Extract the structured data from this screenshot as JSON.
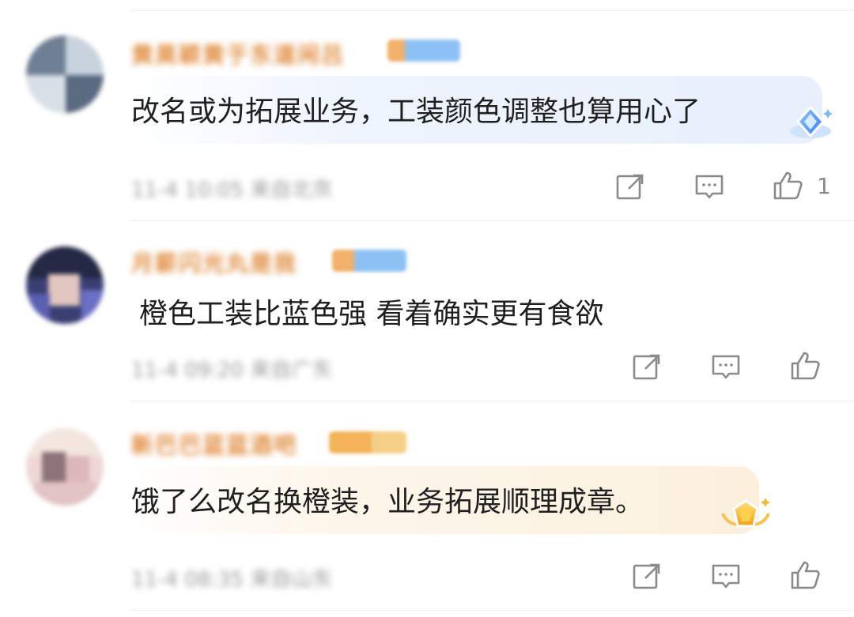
{
  "comments": [
    {
      "username": "黄昊颖黄于东道闲吕",
      "text": "改名或为拓展业务，工装颜色调整也算用心了",
      "meta": "11-4 10:05 来自北京",
      "like_count": "1",
      "bubble_style": "blue",
      "username_color": "#e08a3c",
      "avatar_colors": [
        "#7d8da3",
        "#c9d2dc",
        "#56657a"
      ],
      "badge_icon": "diamond-badge-icon"
    },
    {
      "username": "月薪闪光丸是我",
      "text": "橙色工装比蓝色强 看着确实更有食欲",
      "meta": "11-4 09:20 来自广东",
      "like_count": "",
      "bubble_style": "none",
      "username_color": "#e08a3c",
      "avatar_colors": [
        "#1c2340",
        "#6a6fb8",
        "#e4c8c0"
      ],
      "badge_icon": ""
    },
    {
      "username": "新巴巴蓝蓝酒吧",
      "text": "饿了么改名换橙装，业务拓展顺理成章。",
      "meta": "11-4 08:35 来自山东",
      "like_count": "",
      "bubble_style": "gold",
      "username_color": "#e08a3c",
      "avatar_colors": [
        "#e8c4c6",
        "#f3e7dd",
        "#9a7f86"
      ],
      "badge_icon": "gold-gem-badge-icon"
    }
  ]
}
